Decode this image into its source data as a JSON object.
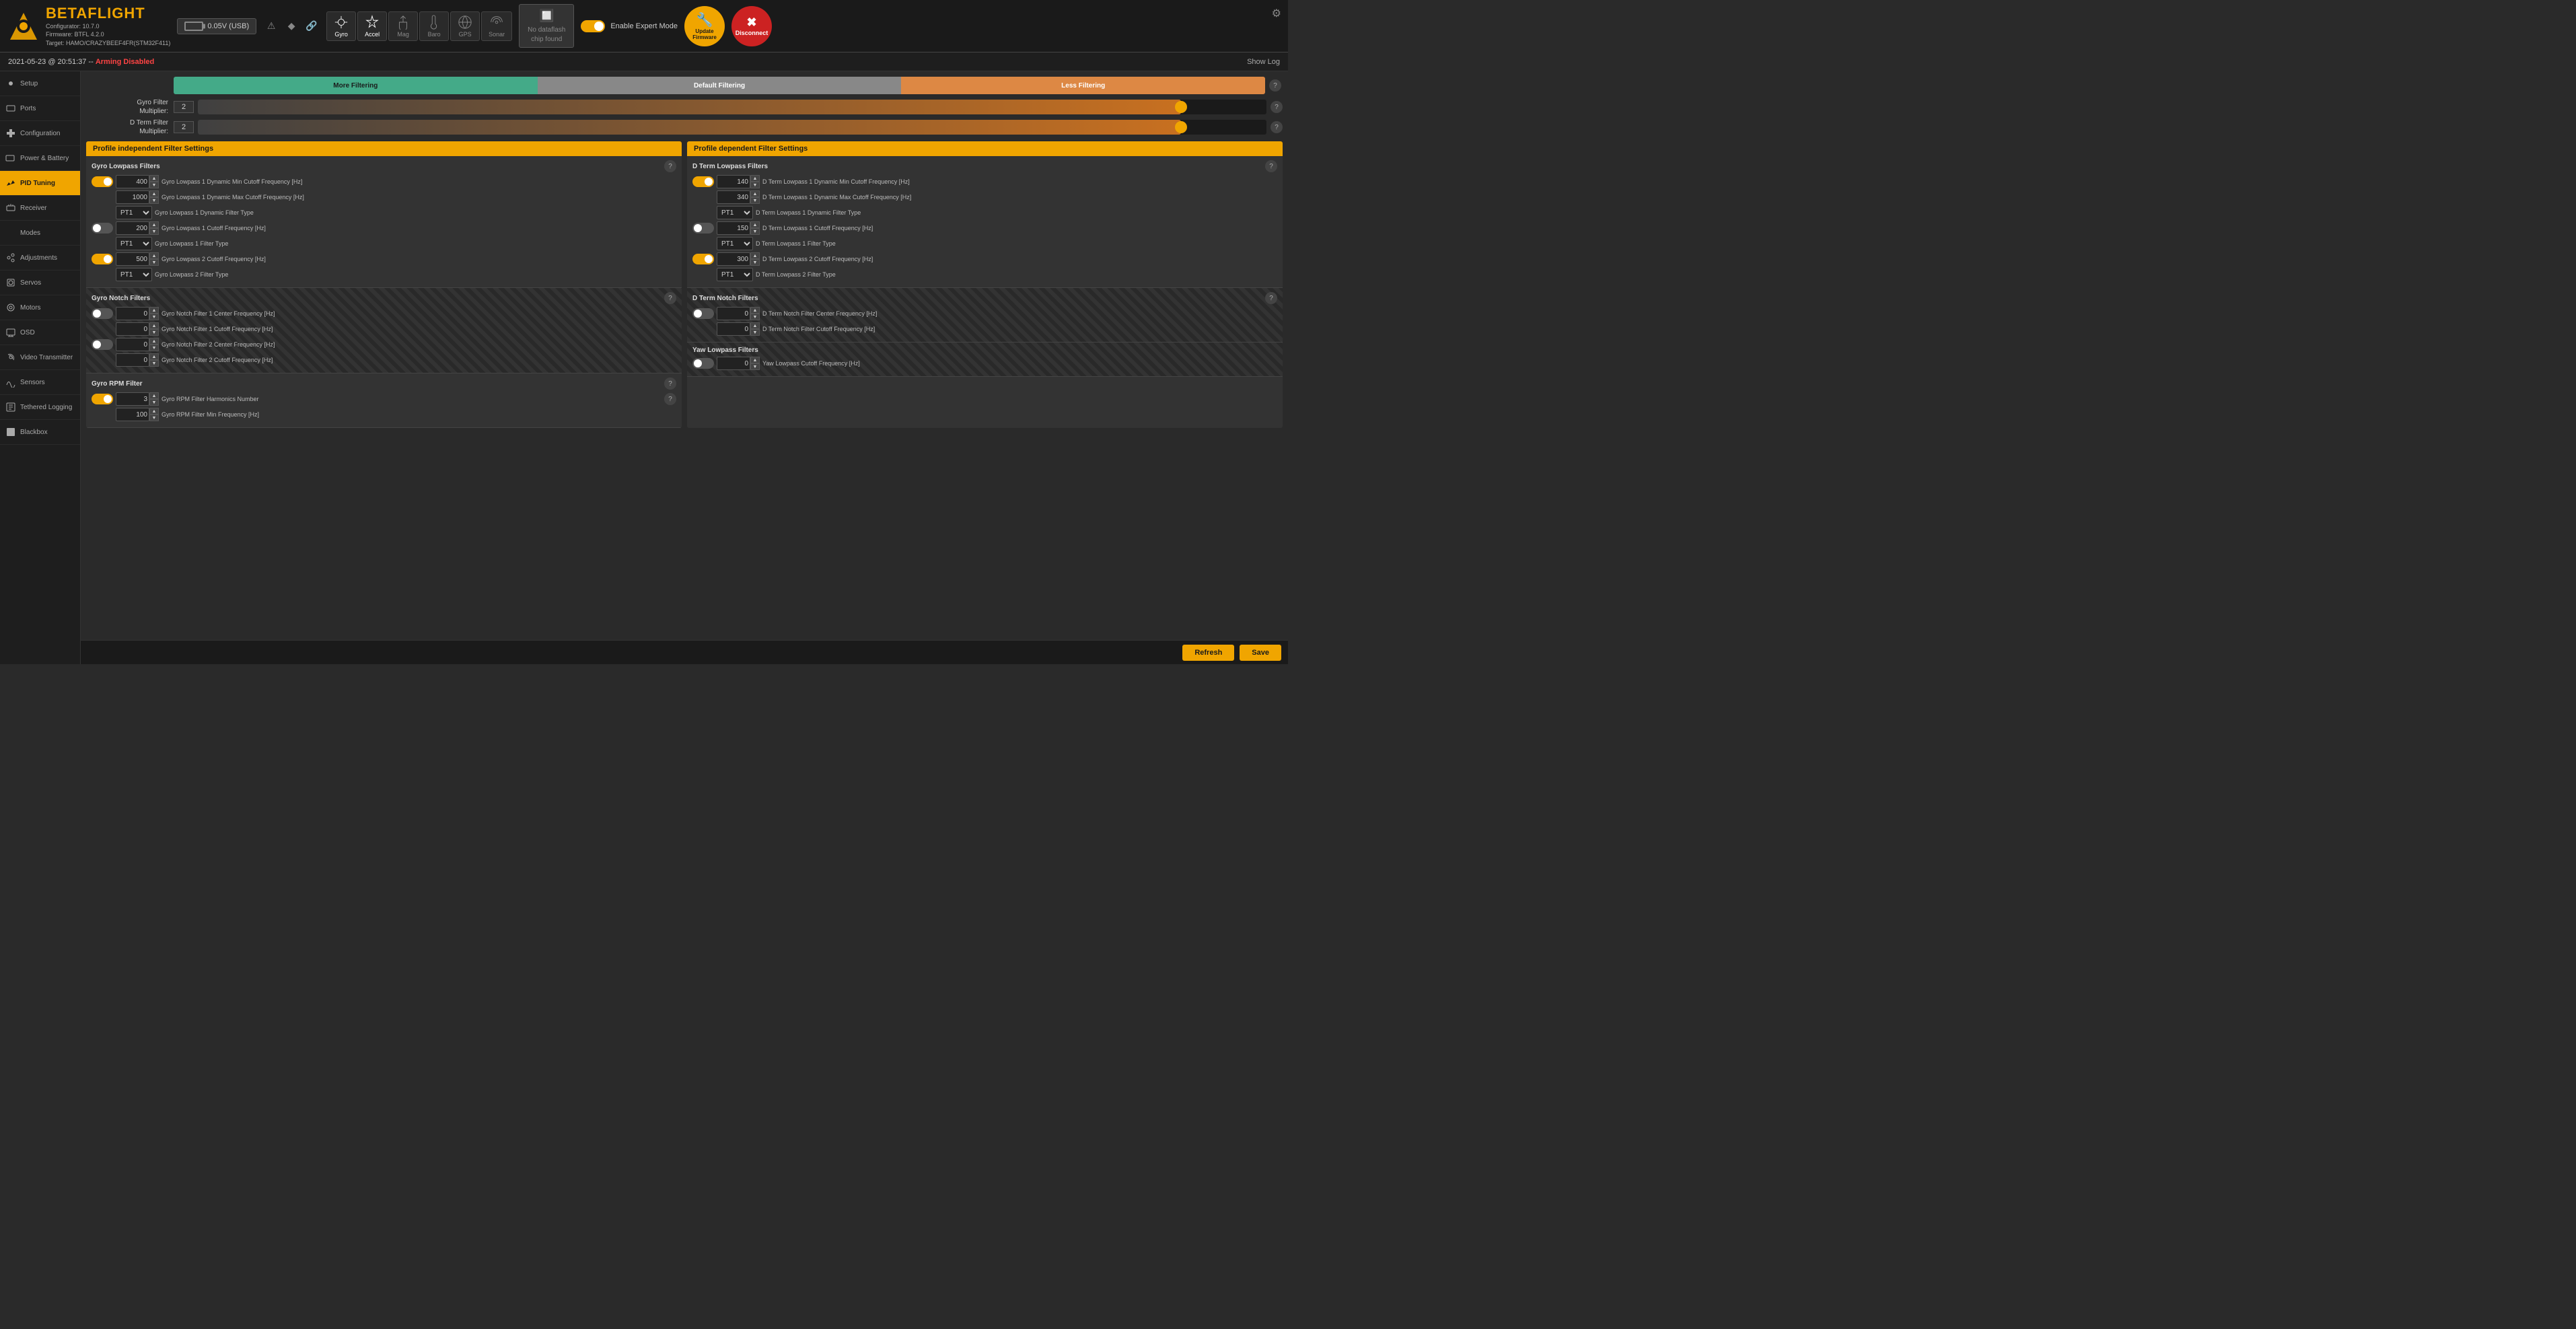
{
  "app": {
    "name": "BETAFLIGHT",
    "configurator": "Configurator: 10.7.0",
    "firmware": "Firmware: BTFL 4.2.0",
    "target": "Target: HAMO/CRAZYBEEF4FR(STM32F411)"
  },
  "header": {
    "voltage": "0.05V (USB)",
    "no_dataflash_line1": "No dataflash",
    "no_dataflash_line2": "chip found",
    "expert_mode_label": "Enable Expert Mode",
    "update_firmware": "Update\nFirmware",
    "disconnect": "Disconnect"
  },
  "sensors": [
    {
      "id": "gyro",
      "label": "Gyro",
      "active": true
    },
    {
      "id": "accel",
      "label": "Accel",
      "active": true
    },
    {
      "id": "mag",
      "label": "Mag",
      "active": false
    },
    {
      "id": "baro",
      "label": "Baro",
      "active": false
    },
    {
      "id": "gps",
      "label": "GPS",
      "active": false
    },
    {
      "id": "sonar",
      "label": "Sonar",
      "active": false
    }
  ],
  "status_bar": {
    "datetime": "2021-05-23 @ 20:51:37 --",
    "arming": "Arming Disabled",
    "show_log": "Show Log"
  },
  "sidebar": {
    "items": [
      {
        "id": "setup",
        "label": "Setup",
        "active": false
      },
      {
        "id": "ports",
        "label": "Ports",
        "active": false
      },
      {
        "id": "configuration",
        "label": "Configuration",
        "active": false
      },
      {
        "id": "power-battery",
        "label": "Power & Battery",
        "active": false
      },
      {
        "id": "pid-tuning",
        "label": "PID Tuning",
        "active": true
      },
      {
        "id": "receiver",
        "label": "Receiver",
        "active": false
      },
      {
        "id": "modes",
        "label": "Modes",
        "active": false
      },
      {
        "id": "adjustments",
        "label": "Adjustments",
        "active": false
      },
      {
        "id": "servos",
        "label": "Servos",
        "active": false
      },
      {
        "id": "motors",
        "label": "Motors",
        "active": false
      },
      {
        "id": "osd",
        "label": "OSD",
        "active": false
      },
      {
        "id": "video-transmitter",
        "label": "Video Transmitter",
        "active": false
      },
      {
        "id": "sensors",
        "label": "Sensors",
        "active": false
      },
      {
        "id": "tethered-logging",
        "label": "Tethered Logging",
        "active": false
      },
      {
        "id": "blackbox",
        "label": "Blackbox",
        "active": false
      }
    ]
  },
  "filter_multipliers": {
    "more_filtering": "More Filtering",
    "default_filtering": "Default Filtering",
    "less_filtering": "Less Filtering",
    "gyro_filter_multiplier_label": "Gyro Filter\nMultiplier:",
    "gyro_filter_multiplier_value": "2",
    "dterm_filter_multiplier_label": "D Term Filter\nMultiplier:",
    "dterm_filter_multiplier_value": "2"
  },
  "left_panel": {
    "title": "Profile independent Filter Settings",
    "gyro_lowpass": {
      "title": "Gyro Lowpass Filters",
      "rows": [
        {
          "toggle": true,
          "value": "400",
          "label": "Gyro Lowpass 1 Dynamic Min Cutoff Frequency [Hz]"
        },
        {
          "toggle": null,
          "value": "1000",
          "label": "Gyro Lowpass 1 Dynamic Max Cutoff Frequency [Hz]"
        },
        {
          "toggle": null,
          "value": "PT1",
          "type": "select",
          "label": "Gyro Lowpass 1 Dynamic Filter Type"
        },
        {
          "toggle": false,
          "value": "200",
          "label": "Gyro Lowpass 1 Cutoff Frequency [Hz]"
        },
        {
          "toggle": null,
          "value": "PT1",
          "type": "select",
          "label": "Gyro Lowpass 1 Filter Type"
        },
        {
          "toggle": true,
          "value": "500",
          "label": "Gyro Lowpass 2 Cutoff Frequency [Hz]"
        },
        {
          "toggle": null,
          "value": "PT1",
          "type": "select",
          "label": "Gyro Lowpass 2 Filter Type"
        }
      ]
    },
    "gyro_notch": {
      "title": "Gyro Notch Filters",
      "rows": [
        {
          "toggle": false,
          "value": "0",
          "label": "Gyro Notch Filter 1 Center Frequency [Hz]"
        },
        {
          "toggle": null,
          "value": "0",
          "label": "Gyro Notch Filter 1 Cutoff Frequency [Hz]"
        },
        {
          "toggle": false,
          "value": "0",
          "label": "Gyro Notch Filter 2 Center Frequency [Hz]"
        },
        {
          "toggle": null,
          "value": "0",
          "label": "Gyro Notch Filter 2 Cutoff Frequency [Hz]"
        }
      ]
    },
    "gyro_rpm": {
      "title": "Gyro RPM Filter",
      "rows": [
        {
          "toggle": true,
          "value": "3",
          "label": "Gyro RPM Filter Harmonics Number"
        },
        {
          "toggle": null,
          "value": "100",
          "label": "Gyro RPM Filter Min Frequency [Hz]"
        }
      ]
    }
  },
  "right_panel": {
    "title": "Profile dependent Filter Settings",
    "dterm_lowpass": {
      "title": "D Term Lowpass Filters",
      "rows": [
        {
          "toggle": true,
          "value": "140",
          "label": "D Term Lowpass 1 Dynamic Min Cutoff Frequency [Hz]"
        },
        {
          "toggle": null,
          "value": "340",
          "label": "D Term Lowpass 1 Dynamic Max Cutoff Frequency [Hz]"
        },
        {
          "toggle": null,
          "value": "PT1",
          "type": "select",
          "label": "D Term Lowpass 1 Dynamic Filter Type"
        },
        {
          "toggle": false,
          "value": "150",
          "label": "D Term Lowpass 1 Cutoff Frequency [Hz]"
        },
        {
          "toggle": null,
          "value": "PT1",
          "type": "select",
          "label": "D Term Lowpass 1 Filter Type"
        },
        {
          "toggle": true,
          "value": "300",
          "label": "D Term Lowpass 2 Cutoff Frequency [Hz]"
        },
        {
          "toggle": null,
          "value": "PT1",
          "type": "select",
          "label": "D Term Lowpass 2 Filter Type"
        }
      ]
    },
    "dterm_notch": {
      "title": "D Term Notch Filters",
      "rows": [
        {
          "toggle": false,
          "value": "0",
          "label": "D Term Notch Filter Center Frequency [Hz]"
        },
        {
          "toggle": null,
          "value": "0",
          "label": "D Term Notch Filter Cutoff Frequency [Hz]"
        }
      ]
    },
    "yaw_lowpass": {
      "title": "Yaw Lowpass Filters",
      "rows": [
        {
          "toggle": false,
          "value": "0",
          "label": "Yaw Lowpass Cutoff Frequency [Hz]"
        }
      ]
    }
  },
  "bottom_bar": {
    "refresh": "Refresh",
    "save": "Save"
  }
}
